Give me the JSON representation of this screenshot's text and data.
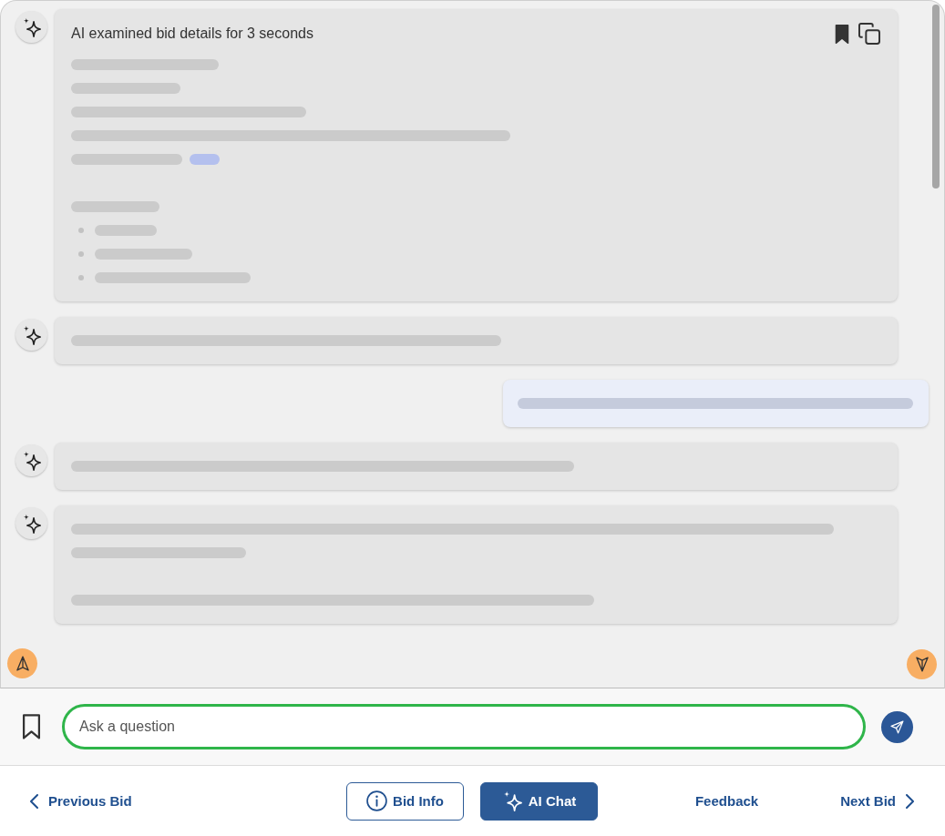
{
  "messages": [
    {
      "kind": "assistant",
      "title": "AI examined bid details for 3 seconds",
      "actions": {
        "bookmarked": true
      },
      "lines": [
        {
          "kind": "text"
        },
        {
          "kind": "text"
        },
        {
          "kind": "text"
        },
        {
          "kind": "text"
        },
        {
          "kind": "text_with_link"
        },
        {
          "kind": "blank"
        },
        {
          "kind": "text"
        },
        {
          "kind": "bullet"
        },
        {
          "kind": "bullet"
        },
        {
          "kind": "bullet"
        }
      ]
    },
    {
      "kind": "assistant",
      "lines": [
        {
          "kind": "text"
        }
      ]
    },
    {
      "kind": "user",
      "lines": [
        {
          "kind": "text"
        }
      ]
    },
    {
      "kind": "assistant",
      "lines": [
        {
          "kind": "text"
        }
      ]
    },
    {
      "kind": "assistant",
      "lines": [
        {
          "kind": "text"
        },
        {
          "kind": "text"
        },
        {
          "kind": "blank"
        },
        {
          "kind": "text"
        }
      ]
    }
  ],
  "composer": {
    "bookmark_filter_on": false,
    "placeholder": "Ask a question",
    "focused": true
  },
  "nav": {
    "previous": "Previous Bid",
    "tabs": [
      {
        "label": "Bid Info",
        "selected": false
      },
      {
        "label": "AI Chat",
        "selected": true
      }
    ],
    "feedback": "Feedback",
    "next": "Next Bid"
  }
}
